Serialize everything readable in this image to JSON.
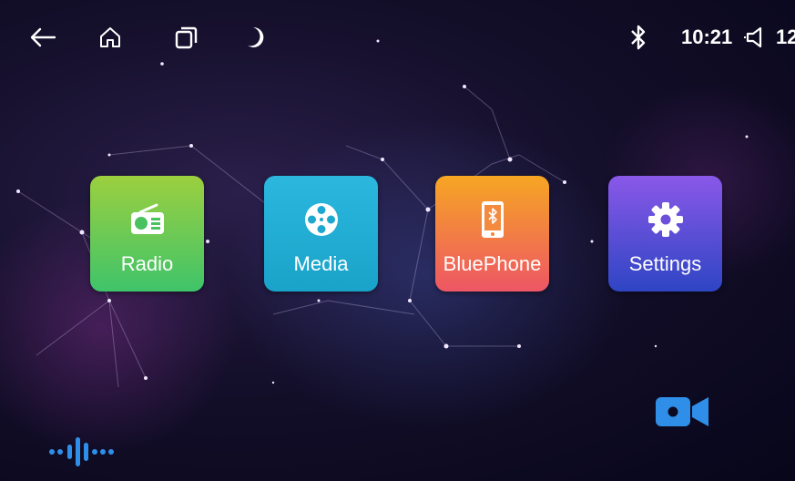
{
  "status_bar": {
    "time": "10:21",
    "volume": "12",
    "icons": [
      "back-arrow-icon",
      "home-icon",
      "recent-apps-icon",
      "night-mode-icon",
      "bluetooth-icon",
      "volume-icon"
    ]
  },
  "apps": [
    {
      "label": "Radio",
      "icon": "radio-icon",
      "color": "#6cc94f"
    },
    {
      "label": "Media",
      "icon": "film-reel-icon",
      "color": "#22aed6"
    },
    {
      "label": "BluePhone",
      "icon": "bluetooth-phone-icon",
      "color": "#f2784a"
    },
    {
      "label": "Settings",
      "icon": "gear-icon",
      "color": "#5a4fd8"
    }
  ],
  "bottom": {
    "voice_icon": "voice-assistant-icon",
    "camera_icon": "camera-icon",
    "accent": "#2f8fe8"
  }
}
